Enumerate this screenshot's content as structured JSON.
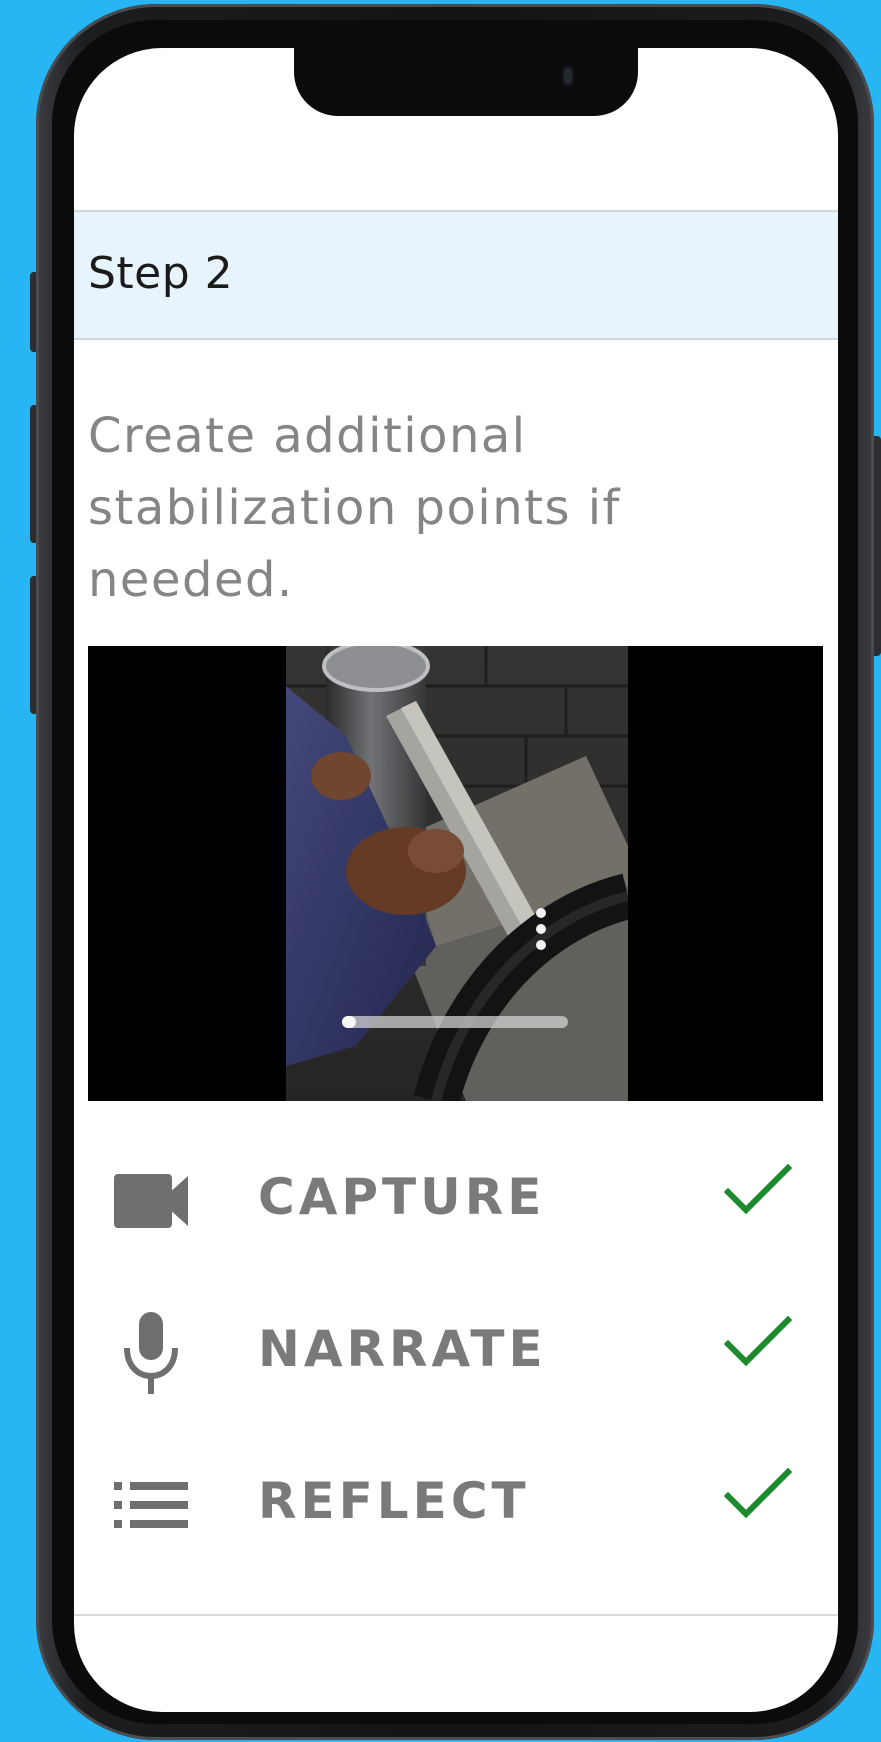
{
  "step": {
    "title": "Step 2"
  },
  "instruction": {
    "text": "Create additional stabilization points if needed."
  },
  "video": {
    "progress": 0.06
  },
  "actions": [
    {
      "label": "CAPTURE",
      "icon": "video-camera-icon",
      "completed": true
    },
    {
      "label": "NARRATE",
      "icon": "microphone-icon",
      "completed": true
    },
    {
      "label": "REFLECT",
      "icon": "list-icon",
      "completed": true
    }
  ],
  "colors": {
    "background": "#27b5f3",
    "header_bg": "#e8f4fb",
    "icon_gray": "#6f6f6f",
    "label_gray": "#7a7a7a",
    "check_green": "#1e8a2e"
  }
}
